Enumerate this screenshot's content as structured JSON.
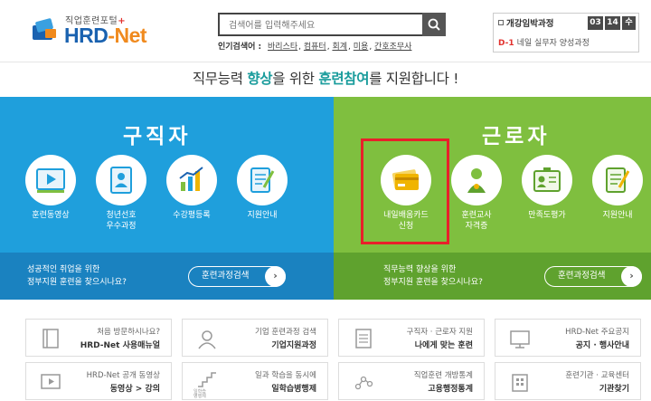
{
  "header": {
    "logo_small": "직업훈련포털",
    "logo_plus": "+",
    "logo_main_a": "HRD",
    "logo_main_b": "-Net",
    "search_placeholder": "검색어를 입력해주세요",
    "popular_label": "인기검색어 :",
    "popular_keywords": [
      "바리스타",
      "컴퓨터",
      "회계",
      "미용",
      "간호조무사"
    ]
  },
  "course_box": {
    "title": "개강임박과정",
    "month": "03",
    "day": "14",
    "weekday": "수",
    "item_dday": "D-1",
    "item_text": "네일 실무자 양성과정"
  },
  "tagline": {
    "p1": "직무능력 ",
    "p2": "향상",
    "p3": "을 위한 ",
    "p4": "훈련참여",
    "p5": "를 지원합니다 !"
  },
  "left_panel": {
    "title": "구직자",
    "items": [
      {
        "label": "훈련동영상"
      },
      {
        "label": "청년선호\n우수과정"
      },
      {
        "label": "수강평등록"
      },
      {
        "label": "지원안내"
      }
    ],
    "bottom_text_1": "성공적인 취업을 위한",
    "bottom_text_2": "정부지원 훈련을 찾으시나요?",
    "bottom_button": "훈련과정검색"
  },
  "right_panel": {
    "title": "근로자",
    "items": [
      {
        "label": "내일배움카드\n신청"
      },
      {
        "label": "훈련교사\n자격증"
      },
      {
        "label": "만족도평가"
      },
      {
        "label": "지원안내"
      }
    ],
    "bottom_text_1": "직무능력 향상을 위한",
    "bottom_text_2": "정부지원 훈련을 찾으시나요?",
    "bottom_button": "훈련과정검색"
  },
  "quick_links": [
    {
      "top": "처음 방문하시나요?",
      "bottom": "HRD-Net 사용매뉴얼",
      "icon": "manual-icon"
    },
    {
      "top": "기업 훈련과정 검색",
      "bottom": "기업지원과정",
      "icon": "company-icon"
    },
    {
      "top": "구직자 · 근로자 지원",
      "bottom": "나에게 맞는 훈련",
      "icon": "checklist-icon"
    },
    {
      "top": "HRD-Net 주요공지",
      "bottom": "공지 · 행사안내",
      "icon": "notice-icon"
    },
    {
      "top": "HRD-Net 공개 동영상",
      "bottom": "동영상 > 강의",
      "icon": "video-icon"
    },
    {
      "top": "일과 학습을 동시에",
      "bottom": "일학습병행제",
      "icon": "stairs-icon"
    },
    {
      "top": "직업훈련 개방통계",
      "bottom": "고용행정통계",
      "icon": "stats-icon"
    },
    {
      "top": "훈련기관 · 교육센터",
      "bottom": "기관찾기",
      "icon": "building-icon"
    }
  ],
  "quick_icon_caption": "일학습\n병행제",
  "colors": {
    "blue_panel": "#1f9fdc",
    "green_panel": "#7fbf3f",
    "highlight": "#e8202a",
    "logo_orange": "#f08a1e",
    "logo_blue": "#1a62b0"
  }
}
